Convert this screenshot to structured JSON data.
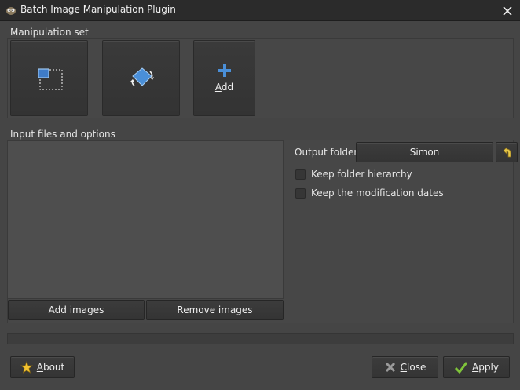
{
  "window": {
    "title": "Batch Image Manipulation Plugin"
  },
  "manipulation_set": {
    "label": "Manipulation set",
    "add_prefix": "A",
    "add_rest": "dd"
  },
  "input": {
    "label": "Input files and options",
    "add_images": "Add images",
    "remove_images": "Remove images"
  },
  "output": {
    "label": "Output folder",
    "folder": "Simon"
  },
  "options": {
    "keep_hierarchy": "Keep folder hierarchy",
    "keep_dates": "Keep the modification dates"
  },
  "footer": {
    "about_prefix": "A",
    "about_rest": "bout",
    "close_prefix": "C",
    "close_rest": "lose",
    "apply_prefix": "A",
    "apply_rest": "pply"
  },
  "colors": {
    "background": "#454545",
    "accent_blue": "#4a8fd8",
    "check_green": "#7fc43a",
    "star_yellow": "#f2c230"
  }
}
